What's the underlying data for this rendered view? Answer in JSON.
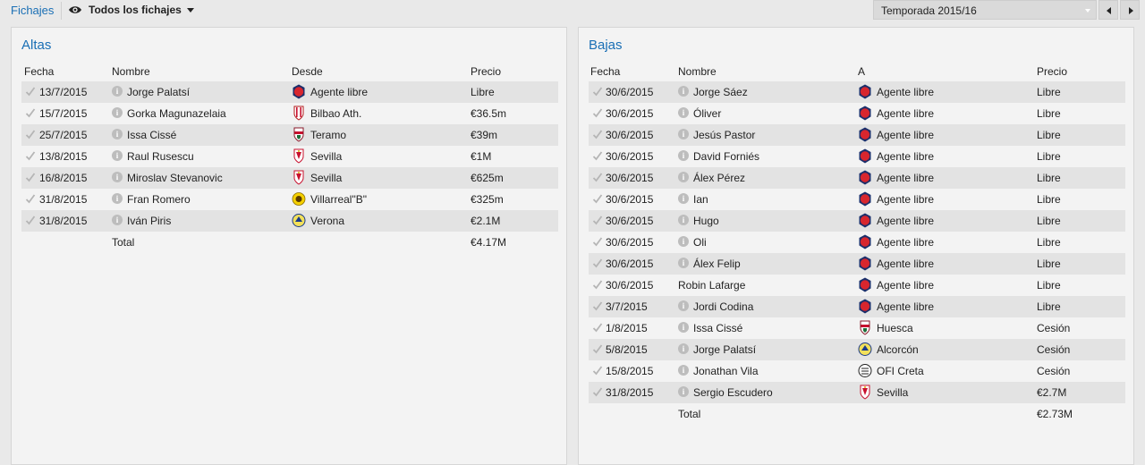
{
  "header": {
    "tab_label": "Fichajes",
    "view_label": "Todos los fichajes",
    "season": "Temporada 2015/16",
    "icons": [
      "eye-icon",
      "caret-down-icon",
      "chevron-left-icon",
      "chevron-right-icon"
    ]
  },
  "altas": {
    "title": "Altas",
    "columns": {
      "date": "Fecha",
      "name": "Nombre",
      "club": "Desde",
      "price": "Precio"
    },
    "rows": [
      {
        "date": "13/7/2015",
        "name": "Jorge Palatsí",
        "club": "Agente libre",
        "price": "Libre",
        "crest": "free-agent"
      },
      {
        "date": "15/7/2015",
        "name": "Gorka Magunazelaia",
        "club": "Bilbao Ath.",
        "price": "€36.5m",
        "crest": "redwhite-stripes"
      },
      {
        "date": "25/7/2015",
        "name": "Issa Cissé",
        "club": "Teramo",
        "price": "€39m",
        "crest": "redwhite-shield"
      },
      {
        "date": "13/8/2015",
        "name": "Raul Rusescu",
        "club": "Sevilla",
        "price": "€1M",
        "crest": "sevilla"
      },
      {
        "date": "16/8/2015",
        "name": "Miroslav Stevanovic",
        "club": "Sevilla",
        "price": "€625m",
        "crest": "sevilla"
      },
      {
        "date": "31/8/2015",
        "name": "Fran Romero",
        "club": "Villarreal\"B\"",
        "price": "€325m",
        "crest": "yellow"
      },
      {
        "date": "31/8/2015",
        "name": "Iván Piris",
        "club": "Verona",
        "price": "€2.1M",
        "crest": "yellow-blue"
      }
    ],
    "total_label": "Total",
    "total_value": "€4.17M"
  },
  "bajas": {
    "title": "Bajas",
    "columns": {
      "date": "Fecha",
      "name": "Nombre",
      "club": "A",
      "price": "Precio"
    },
    "rows": [
      {
        "date": "30/6/2015",
        "name": "Jorge Sáez",
        "club": "Agente libre",
        "price": "Libre",
        "crest": "free-agent",
        "info": true
      },
      {
        "date": "30/6/2015",
        "name": "Óliver",
        "club": "Agente libre",
        "price": "Libre",
        "crest": "free-agent",
        "info": true
      },
      {
        "date": "30/6/2015",
        "name": "Jesús Pastor",
        "club": "Agente libre",
        "price": "Libre",
        "crest": "free-agent",
        "info": true
      },
      {
        "date": "30/6/2015",
        "name": "David Forniés",
        "club": "Agente libre",
        "price": "Libre",
        "crest": "free-agent",
        "info": true
      },
      {
        "date": "30/6/2015",
        "name": "Álex Pérez",
        "club": "Agente libre",
        "price": "Libre",
        "crest": "free-agent",
        "info": true
      },
      {
        "date": "30/6/2015",
        "name": "Ian",
        "club": "Agente libre",
        "price": "Libre",
        "crest": "free-agent",
        "info": true
      },
      {
        "date": "30/6/2015",
        "name": "Hugo",
        "club": "Agente libre",
        "price": "Libre",
        "crest": "free-agent",
        "info": true
      },
      {
        "date": "30/6/2015",
        "name": "Oli",
        "club": "Agente libre",
        "price": "Libre",
        "crest": "free-agent",
        "info": true
      },
      {
        "date": "30/6/2015",
        "name": "Álex Felip",
        "club": "Agente libre",
        "price": "Libre",
        "crest": "free-agent",
        "info": true
      },
      {
        "date": "30/6/2015",
        "name": "Robin Lafarge",
        "club": "Agente libre",
        "price": "Libre",
        "crest": "free-agent",
        "info": false
      },
      {
        "date": "3/7/2015",
        "name": "Jordi Codina",
        "club": "Agente libre",
        "price": "Libre",
        "crest": "free-agent",
        "info": true
      },
      {
        "date": "1/8/2015",
        "name": "Issa Cissé",
        "club": "Huesca",
        "price": "Cesión",
        "crest": "redwhite-shield",
        "info": true
      },
      {
        "date": "5/8/2015",
        "name": "Jorge Palatsí",
        "club": "Alcorcón",
        "price": "Cesión",
        "crest": "yellow-blue",
        "info": true
      },
      {
        "date": "15/8/2015",
        "name": "Jonathan Vila",
        "club": "OFI Creta",
        "price": "Cesión",
        "crest": "blackwhite",
        "info": true
      },
      {
        "date": "31/8/2015",
        "name": "Sergio Escudero",
        "club": "Sevilla",
        "price": "€2.7M",
        "crest": "sevilla",
        "info": true
      }
    ],
    "total_label": "Total",
    "total_value": "€2.73M"
  }
}
